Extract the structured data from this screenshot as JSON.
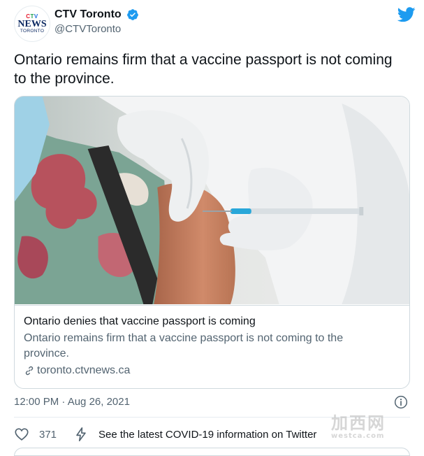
{
  "author": {
    "display_name": "CTV Toronto",
    "handle": "@CTVToronto",
    "avatar_logo": {
      "top": "CTV",
      "middle": "NEWS",
      "bottom": "TORONTO"
    },
    "verified_icon": "verified-badge-icon"
  },
  "brand_icon": "twitter-bird-icon",
  "tweet_text": "Ontario remains firm that a vaccine passport is not coming to the province.",
  "card": {
    "image_description": "photo-vaccine-injection",
    "title": "Ontario denies that vaccine passport is coming",
    "description": "Ontario remains firm that a vaccine passport is not coming to the province.",
    "link_icon": "link-icon",
    "domain": "toronto.ctvnews.ca"
  },
  "timestamp": "12:00 PM · Aug 26, 2021",
  "info_icon": "info-icon",
  "actions": {
    "like_icon": "heart-icon",
    "like_count": "371",
    "covid_icon": "lightning-icon",
    "covid_label": "See the latest COVID-19 information on Twitter"
  },
  "colors": {
    "twitter_blue": "#1d9bf0",
    "text_primary": "#0f1419",
    "text_secondary": "#536471",
    "border": "#cfd9de"
  }
}
